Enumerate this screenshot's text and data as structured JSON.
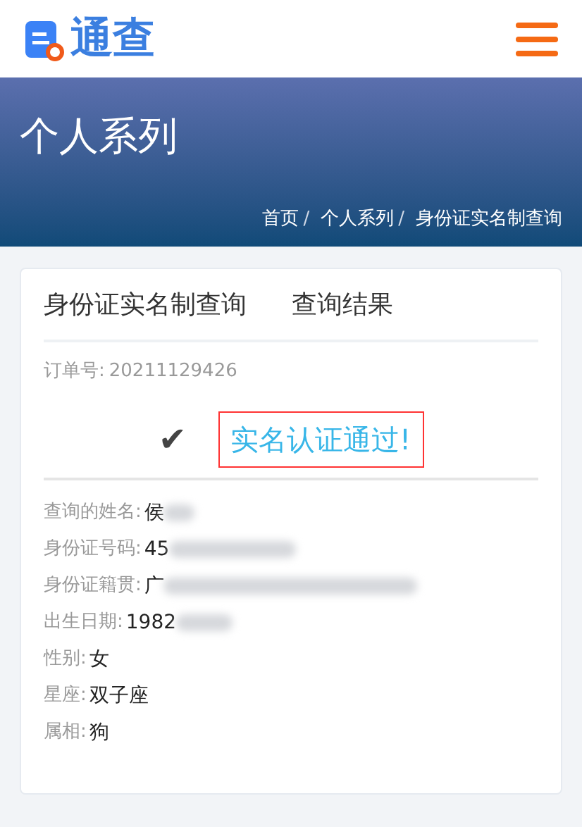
{
  "header": {
    "logo_text": "通查"
  },
  "banner": {
    "title": "个人系列",
    "breadcrumb": [
      {
        "label": "首页",
        "separator": "/"
      },
      {
        "label": "个人系列",
        "separator": "/"
      },
      {
        "label": "身份证实名制查询"
      }
    ]
  },
  "card": {
    "title": "身份证实名制查询",
    "subtitle": "查询结果",
    "order": {
      "label": "订单号:",
      "value": "20211129426"
    },
    "result": {
      "icon": "✔",
      "message": "实名认证通过!"
    },
    "fields": [
      {
        "label": "查询的姓名:",
        "value": "侯",
        "redacted": true
      },
      {
        "label": "身份证号码:",
        "value": "45",
        "redacted": true
      },
      {
        "label": "身份证籍贯:",
        "value": "广",
        "redacted": true
      },
      {
        "label": "出生日期:",
        "value": "1982",
        "redacted": true
      },
      {
        "label": "性别:",
        "value": "女",
        "redacted": false
      },
      {
        "label": "星座:",
        "value": "双子座",
        "redacted": false
      },
      {
        "label": "属相:",
        "value": "狗",
        "redacted": false
      }
    ]
  }
}
